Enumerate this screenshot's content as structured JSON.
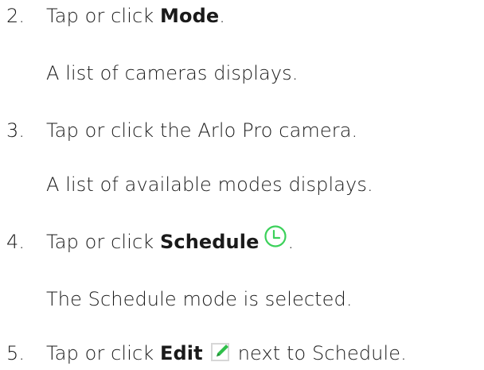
{
  "steps": [
    {
      "number": "2.",
      "prefix": "Tap or click ",
      "bold": "Mode",
      "suffix": ".",
      "result": "A list of cameras displays."
    },
    {
      "number": "3.",
      "text": "Tap or click the Arlo Pro camera.",
      "result": "A list of available modes displays."
    },
    {
      "number": "4.",
      "prefix": "Tap or click ",
      "bold": "Schedule",
      "icon": "clock-icon",
      "suffix": ".",
      "result": "The Schedule mode is selected."
    },
    {
      "number": "5.",
      "prefix": "Tap or click ",
      "bold": "Edit",
      "icon": "pencil-edit-icon",
      "suffix": "next to Schedule."
    }
  ],
  "colors": {
    "text": "#1a1a1a",
    "clock_icon": "#3bd15a",
    "edit_icon_bg": "#d7d7d7",
    "edit_icon_pencil": "#2fbf4a"
  }
}
